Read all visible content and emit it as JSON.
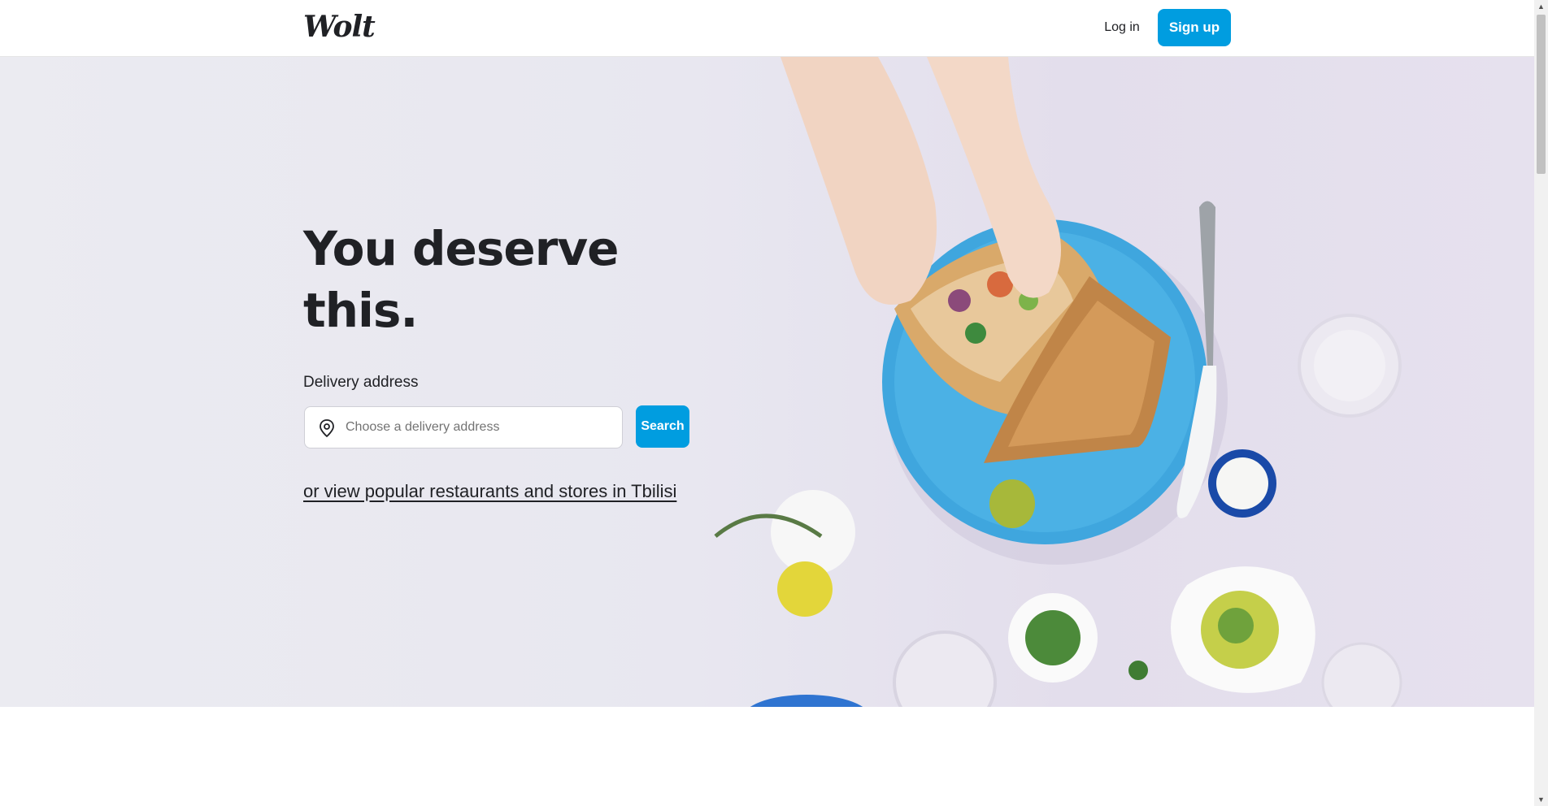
{
  "header": {
    "logo": "Wolt",
    "login_label": "Log in",
    "signup_label": "Sign up"
  },
  "hero": {
    "headline_line1": "You deserve",
    "headline_line2": "this.",
    "address_label": "Delivery address",
    "address_placeholder": "Choose a delivery address",
    "address_value": "",
    "search_label": "Search",
    "popular_link": "or view popular restaurants and stores in Tbilisi"
  },
  "icons": {
    "address_field": "location-pin-icon"
  },
  "colors": {
    "brand_blue": "#009de0",
    "hero_background": "#e8e7f0",
    "text": "#202125"
  }
}
